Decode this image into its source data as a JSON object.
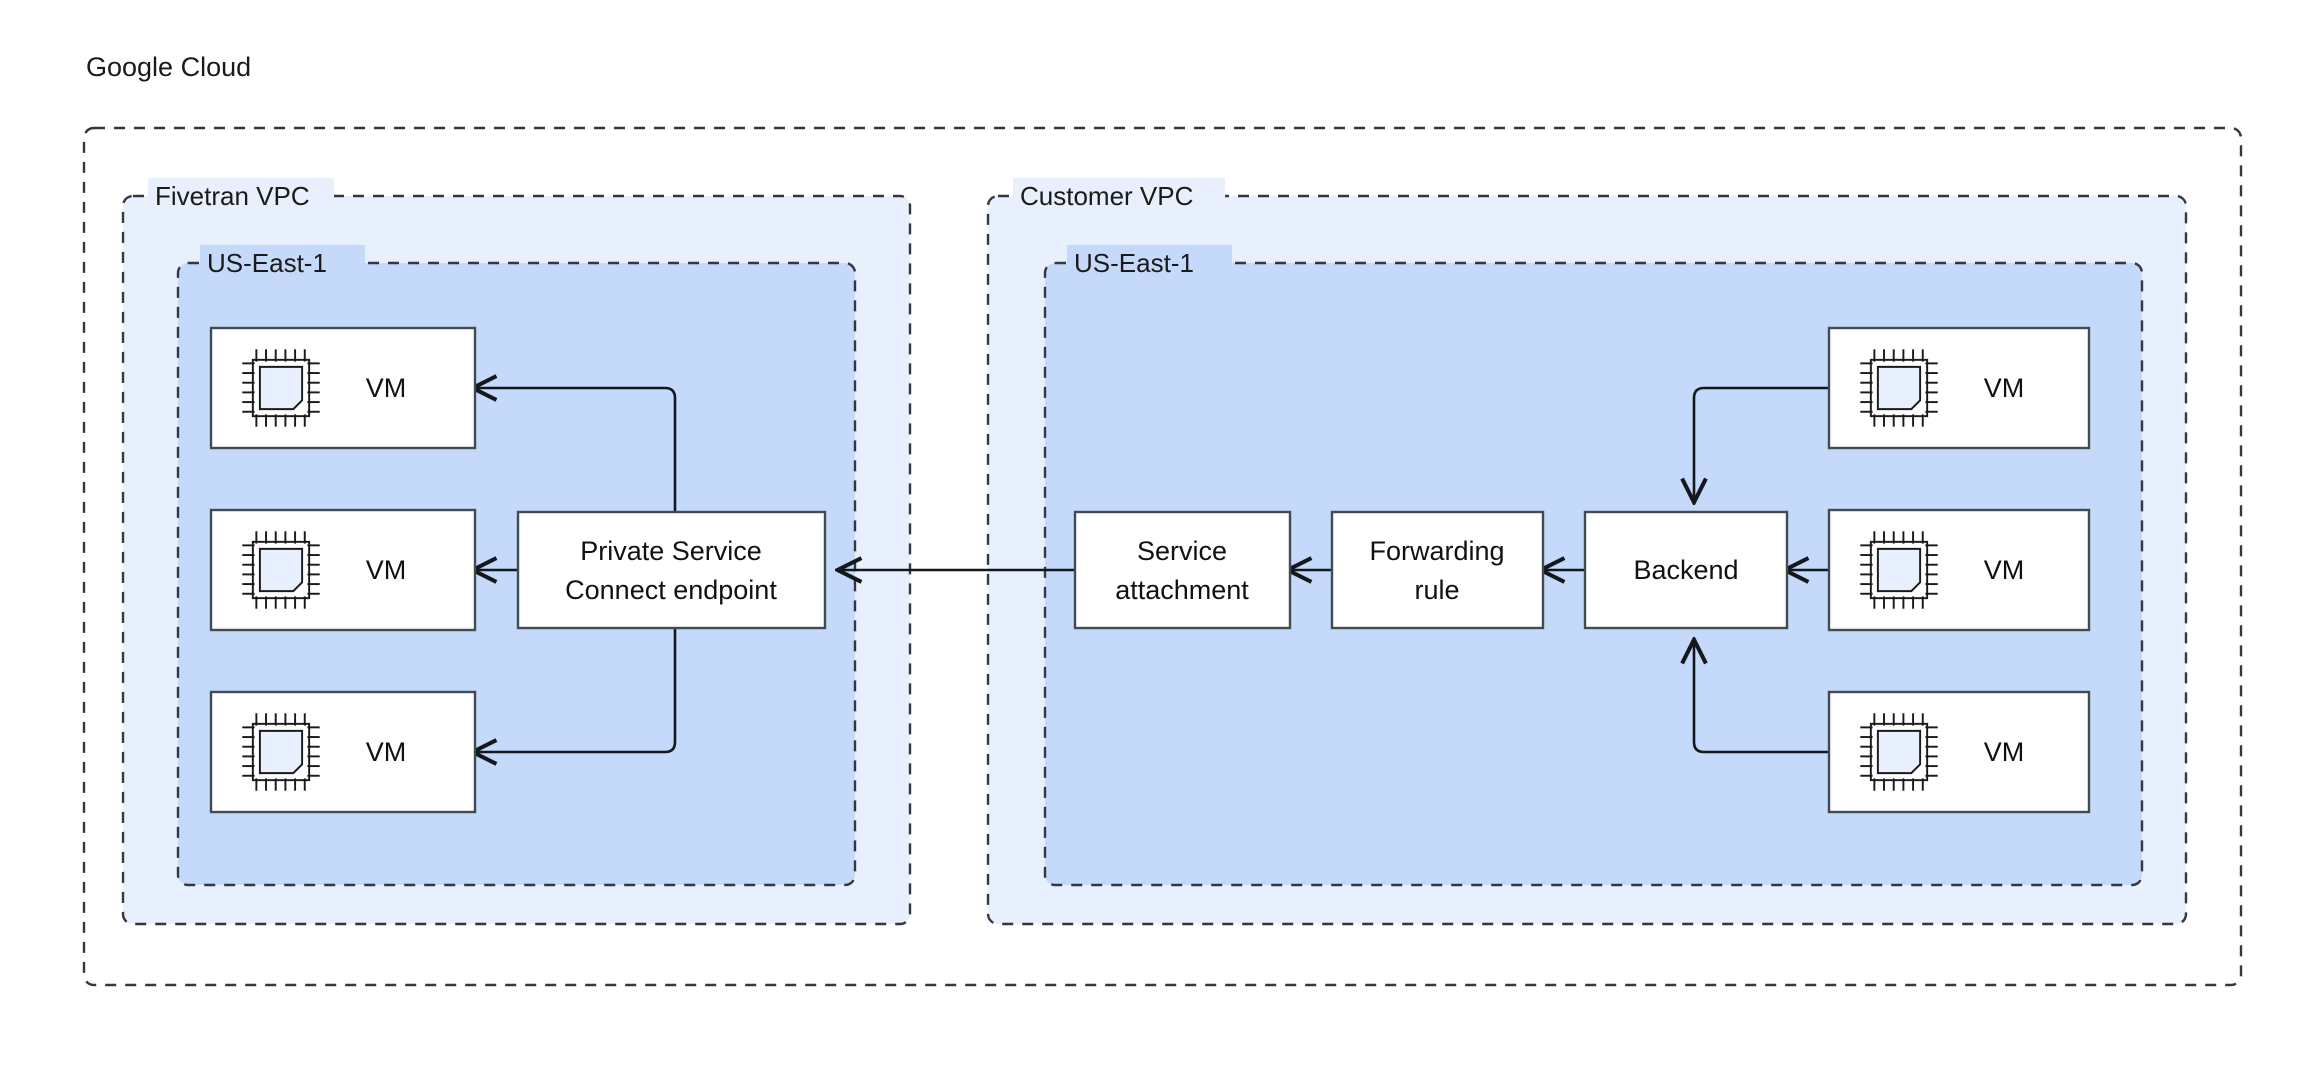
{
  "cloud": {
    "title": "Google Cloud"
  },
  "vpcs": [
    {
      "name": "fivetran-vpc",
      "label": "Fivetran VPC",
      "region": {
        "label": "US-East-1"
      },
      "nodes": [
        {
          "id": "ft-vm-1",
          "label": "VM",
          "icon": "cpu-chip-icon"
        },
        {
          "id": "ft-vm-2",
          "label": "VM",
          "icon": "cpu-chip-icon"
        },
        {
          "id": "ft-vm-3",
          "label": "VM",
          "icon": "cpu-chip-icon"
        },
        {
          "id": "psc-endpoint",
          "label_line1": "Private Service",
          "label_line2": "Connect endpoint"
        }
      ]
    },
    {
      "name": "customer-vpc",
      "label": "Customer VPC",
      "region": {
        "label": "US-East-1"
      },
      "nodes": [
        {
          "id": "service-attachment",
          "label_line1": "Service",
          "label_line2": "attachment"
        },
        {
          "id": "forwarding-rule",
          "label_line1": "Forwarding",
          "label_line2": "rule"
        },
        {
          "id": "backend",
          "label_line1": "Backend",
          "label_line2": ""
        },
        {
          "id": "cust-vm-1",
          "label": "VM",
          "icon": "cpu-chip-icon"
        },
        {
          "id": "cust-vm-2",
          "label": "VM",
          "icon": "cpu-chip-icon"
        },
        {
          "id": "cust-vm-3",
          "label": "VM",
          "icon": "cpu-chip-icon"
        }
      ]
    }
  ],
  "connections": [
    {
      "from": "psc-endpoint",
      "to": "ft-vm-1",
      "style": "elbow-up-left"
    },
    {
      "from": "psc-endpoint",
      "to": "ft-vm-2",
      "style": "straight-left"
    },
    {
      "from": "psc-endpoint",
      "to": "ft-vm-3",
      "style": "elbow-down-left"
    },
    {
      "from": "service-attachment",
      "to": "psc-endpoint",
      "style": "straight-left"
    },
    {
      "from": "forwarding-rule",
      "to": "service-attachment",
      "style": "straight-left"
    },
    {
      "from": "backend",
      "to": "forwarding-rule",
      "style": "straight-left"
    },
    {
      "from": "cust-vm-1",
      "to": "backend",
      "style": "elbow-left-down"
    },
    {
      "from": "cust-vm-2",
      "to": "backend",
      "style": "straight-left"
    },
    {
      "from": "cust-vm-3",
      "to": "backend",
      "style": "elbow-left-up"
    }
  ],
  "colors": {
    "vpc_fill": "#e8effd",
    "region_fill": "#c5d9fb",
    "node_fill": "#ffffff",
    "border": "#32383d",
    "line": "#13181c",
    "page_background": "#ffffff",
    "outer_background": "#000000"
  }
}
